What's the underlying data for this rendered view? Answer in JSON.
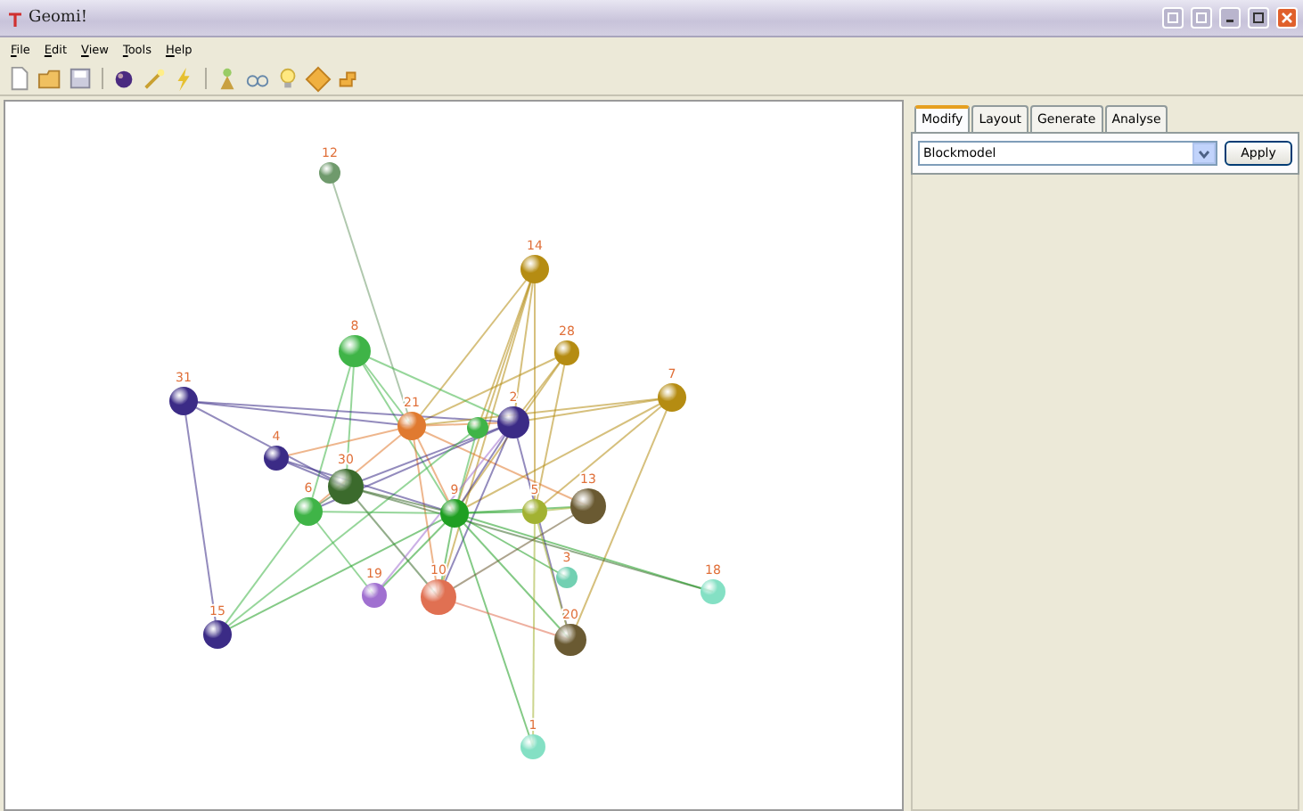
{
  "window": {
    "title": "Geomi!"
  },
  "menu": [
    "File",
    "Edit",
    "View",
    "Tools",
    "Help"
  ],
  "tabs": [
    {
      "label": "Modify",
      "selected": true
    },
    {
      "label": "Layout",
      "selected": false
    },
    {
      "label": "Generate",
      "selected": false
    },
    {
      "label": "Analyse",
      "selected": false
    }
  ],
  "model_select": {
    "value": "Blockmodel"
  },
  "apply_button": "Apply",
  "graph": {
    "nodes": [
      {
        "label": "12",
        "color": "#6f9a6c"
      },
      {
        "label": "14",
        "color": "#b58c12"
      },
      {
        "label": "28",
        "color": "#b58c12"
      },
      {
        "label": "8",
        "color": "#3fb447"
      },
      {
        "label": "31",
        "color": "#3b2b86"
      },
      {
        "label": "7",
        "color": "#b58c12"
      },
      {
        "label": "21",
        "color": "#e07a30"
      },
      {
        "label": "2",
        "color": "#3b2b86"
      },
      {
        "color": "#3fb447"
      },
      {
        "label": "4",
        "color": "#3b2b86"
      },
      {
        "label": "30",
        "color": "#3b6a2c"
      },
      {
        "label": "6",
        "color": "#3fb447"
      },
      {
        "label": "9",
        "color": "#1f9f22"
      },
      {
        "label": "5",
        "color": "#a2b232"
      },
      {
        "label": "13",
        "color": "#6a5a32"
      },
      {
        "label": "3",
        "color": "#72d0b2"
      },
      {
        "label": "19",
        "color": "#a070d0"
      },
      {
        "label": "10",
        "color": "#e07052"
      },
      {
        "label": "15",
        "color": "#3b2b86"
      },
      {
        "label": "18",
        "color": "#84e0c4"
      },
      {
        "label": "20",
        "color": "#6a5a32"
      },
      {
        "label": "1",
        "color": "#84e0c4"
      }
    ]
  }
}
